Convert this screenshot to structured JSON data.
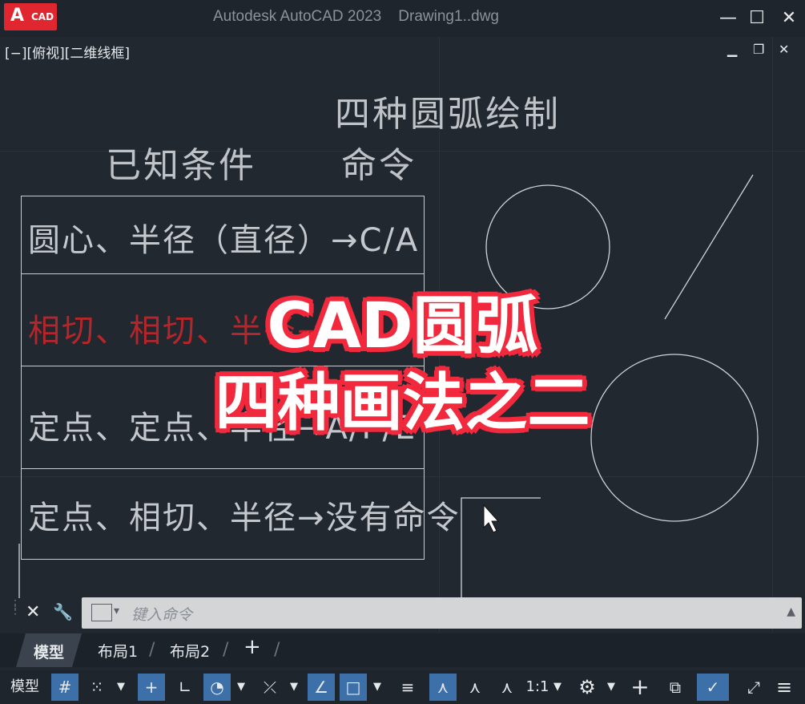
{
  "titlebar": {
    "logo_letter": "A",
    "logo_text": "CAD",
    "title": "Autodesk AutoCAD 2023    Drawing1..dwg",
    "minimize": "—",
    "maximize": "☐",
    "close": "✕"
  },
  "viewport": {
    "label": "[−][俯视][二维线框]",
    "controls": [
      "▁",
      "❐",
      "✕"
    ]
  },
  "drawing": {
    "heading": "四种圆弧绘制",
    "col_left": "已知条件",
    "col_right": "命令",
    "rows": [
      {
        "text": "圆心、半径（直径）→C/A",
        "color": "#c4c8cc"
      },
      {
        "text": "相切、相切、半径→T",
        "color": "#b4262a"
      },
      {
        "text": "定点、定点、半径→A/P/E",
        "color": "#c4c8cc"
      },
      {
        "text": "定点、相切、半径→没有命令",
        "color": "#c4c8cc"
      }
    ]
  },
  "overlay": {
    "line1": "CAD圆弧",
    "line2": "四种画法之二",
    "color": "#f2283c"
  },
  "command": {
    "placeholder": "键入命令",
    "close_icon": "✕",
    "wrench_icon": "🔧"
  },
  "layout_tabs": {
    "model": "模型",
    "layout1": "布局1",
    "layout2": "布局2",
    "add": "+"
  },
  "statusbar": {
    "model": "模型",
    "scale": "1:1"
  }
}
